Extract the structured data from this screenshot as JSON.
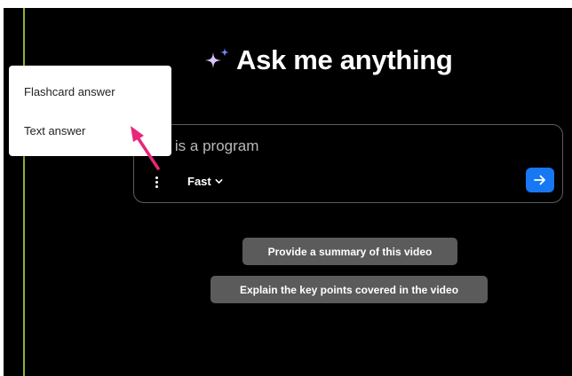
{
  "header": {
    "title": "Ask me anything",
    "title_icon": "sparkle-icon"
  },
  "input": {
    "query_visible_text": "at is a program",
    "options_icon": "vertical-ellipsis-icon",
    "speed_label": "Fast",
    "speed_icon": "chevron-down-icon",
    "send_icon": "arrow-right-icon"
  },
  "suggestions": [
    {
      "label": "Provide a summary of this video"
    },
    {
      "label": "Explain the key points covered in the video"
    }
  ],
  "dropdown": {
    "items": [
      {
        "label": "Flashcard answer"
      },
      {
        "label": "Text answer"
      }
    ]
  },
  "annotation": {
    "icon": "pointer-arrow-icon"
  },
  "colors": {
    "background": "#000000",
    "accent_rule": "#8db33a",
    "send_button": "#1877f2",
    "chip": "#5b5b5b",
    "annotation_arrow": "#e8277a",
    "sparkle_primary": "#d9c4ff",
    "sparkle_secondary": "#6f8bff"
  }
}
